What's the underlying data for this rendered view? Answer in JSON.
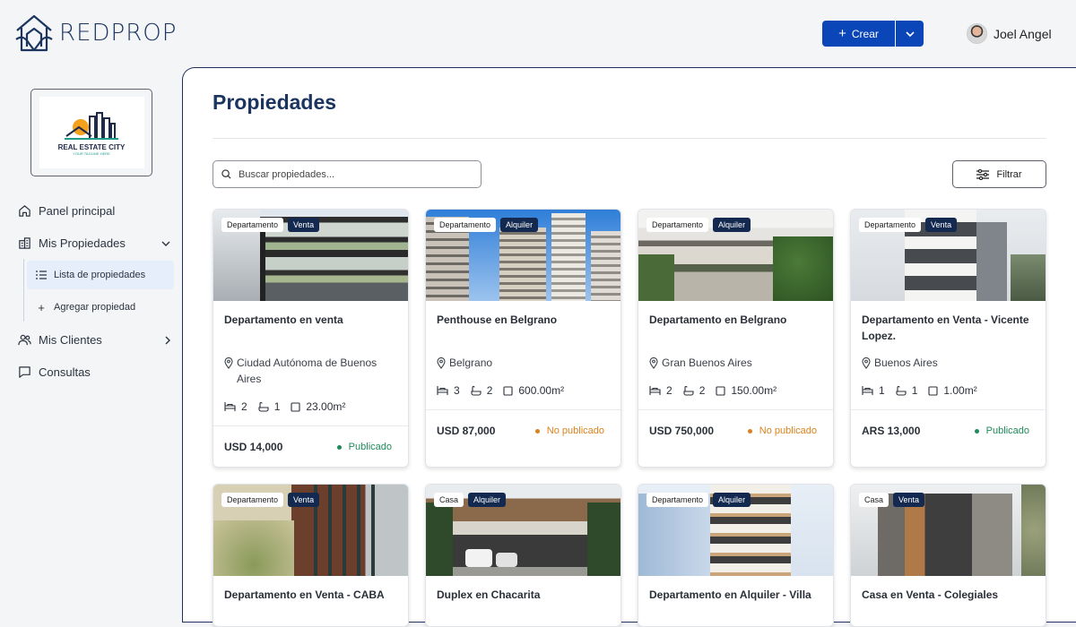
{
  "app": {
    "name": "REDPROP"
  },
  "header": {
    "create_label": "Crear",
    "user_name": "Joel Angel"
  },
  "brand": {
    "name": "REAL ESTATE CITY",
    "tagline": "YOUR TAGLINE HERE"
  },
  "sidebar": {
    "items": [
      {
        "label": "Panel principal"
      },
      {
        "label": "Mis Propiedades"
      },
      {
        "label": "Lista de propiedades"
      },
      {
        "label": "Agregar propiedad"
      },
      {
        "label": "Mis Clientes"
      },
      {
        "label": "Consultas"
      }
    ]
  },
  "main": {
    "title": "Propiedades",
    "search_placeholder": "Buscar propiedades...",
    "filter_label": "Filtrar"
  },
  "properties": [
    {
      "type": "Departamento",
      "operation": "Venta",
      "title": "Departamento en venta",
      "location": "Ciudad Autónoma de Buenos Aires",
      "rooms": "2",
      "baths": "1",
      "area": "23.00m²",
      "price": "USD 14,000",
      "status": "Publicado",
      "status_color": "#1f8a5a"
    },
    {
      "type": "Departamento",
      "operation": "Alquiler",
      "title": "Penthouse en Belgrano",
      "location": "Belgrano",
      "rooms": "3",
      "baths": "2",
      "area": "600.00m²",
      "price": "USD 87,000",
      "status": "No publicado",
      "status_color": "#d9821e"
    },
    {
      "type": "Departamento",
      "operation": "Alquiler",
      "title": "Departamento en Belgrano",
      "location": "Gran Buenos Aires",
      "rooms": "2",
      "baths": "2",
      "area": "150.00m²",
      "price": "USD 750,000",
      "status": "No publicado",
      "status_color": "#d9821e"
    },
    {
      "type": "Departamento",
      "operation": "Venta",
      "title": "Departamento en Venta - Vicente Lopez.",
      "location": "Buenos Aires",
      "rooms": "1",
      "baths": "1",
      "area": "1.00m²",
      "price": "ARS 13,000",
      "status": "Publicado",
      "status_color": "#1f8a5a"
    },
    {
      "type": "Departamento",
      "operation": "Venta",
      "title": "Departamento en Venta - CABA"
    },
    {
      "type": "Casa",
      "operation": "Alquiler",
      "title": "Duplex en Chacarita"
    },
    {
      "type": "Departamento",
      "operation": "Alquiler",
      "title": "Departamento en Alquiler - Villa"
    },
    {
      "type": "Casa",
      "operation": "Venta",
      "title": "Casa en Venta - Colegiales"
    }
  ],
  "colors": {
    "primary": "#0b46b8",
    "navy": "#1b3560",
    "badge": "#13294f"
  }
}
